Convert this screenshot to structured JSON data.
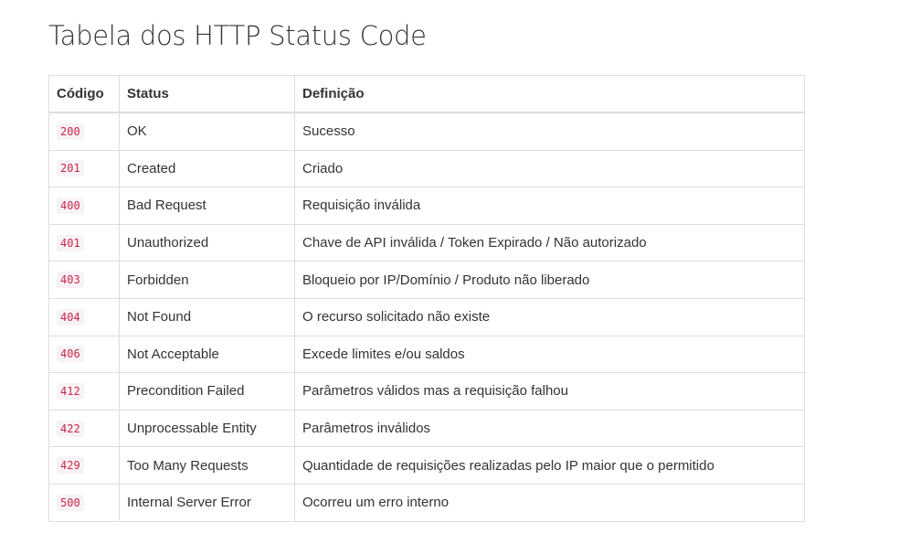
{
  "page": {
    "title": "Tabela dos HTTP Status Code"
  },
  "table": {
    "headers": [
      "Código",
      "Status",
      "Definição"
    ],
    "rows": [
      {
        "code": "200",
        "status": "OK",
        "definition": "Sucesso"
      },
      {
        "code": "201",
        "status": "Created",
        "definition": "Criado"
      },
      {
        "code": "400",
        "status": "Bad Request",
        "definition": "Requisição inválida"
      },
      {
        "code": "401",
        "status": "Unauthorized",
        "definition": "Chave de API inválida / Token Expirado / Não autorizado"
      },
      {
        "code": "403",
        "status": "Forbidden",
        "definition": "Bloqueio por IP/Domínio / Produto não liberado"
      },
      {
        "code": "404",
        "status": "Not Found",
        "definition": "O recurso solicitado não existe"
      },
      {
        "code": "406",
        "status": "Not Acceptable",
        "definition": "Excede limites e/ou saldos"
      },
      {
        "code": "412",
        "status": "Precondition Failed",
        "definition": "Parâmetros válidos mas a requisição falhou"
      },
      {
        "code": "422",
        "status": "Unprocessable Entity",
        "definition": "Parâmetros inválidos"
      },
      {
        "code": "429",
        "status": "Too Many Requests",
        "definition": "Quantidade de requisições realizadas pelo IP maior que o permitido"
      },
      {
        "code": "500",
        "status": "Internal Server Error",
        "definition": "Ocorreu um erro interno"
      }
    ]
  },
  "colors": {
    "code_text": "#c7254e",
    "code_background": "#f9f2f4",
    "table_border": "#dddddd",
    "text": "#333333"
  }
}
